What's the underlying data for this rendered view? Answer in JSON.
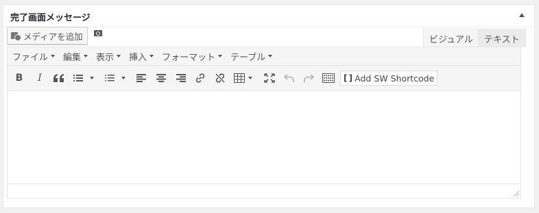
{
  "postbox": {
    "title": "完了画面メッセージ",
    "toggle_icon": "triangle-up"
  },
  "media": {
    "add_media_label": "メディアを追加",
    "add_media_icon": "media-icon",
    "camera_icon": "camera-icon"
  },
  "tabs": {
    "visual_label": "ビジュアル",
    "text_label": "テキスト",
    "active": "visual"
  },
  "menubar": {
    "items": [
      {
        "label": "ファイル"
      },
      {
        "label": "編集"
      },
      {
        "label": "表示"
      },
      {
        "label": "挿入"
      },
      {
        "label": "フォーマット"
      },
      {
        "label": "テーブル"
      }
    ]
  },
  "toolbar": {
    "bold": "B",
    "italic": "I",
    "quote": "66",
    "shortcode_label": "Add SW Shortcode",
    "shortcode_bracket": "[ ]"
  },
  "colors": {
    "accent": "#23282d",
    "toolbar_bg": "#f5f5f5",
    "border": "#e5e5e5",
    "icon": "#555555",
    "icon_disabled": "#b4b9be"
  }
}
